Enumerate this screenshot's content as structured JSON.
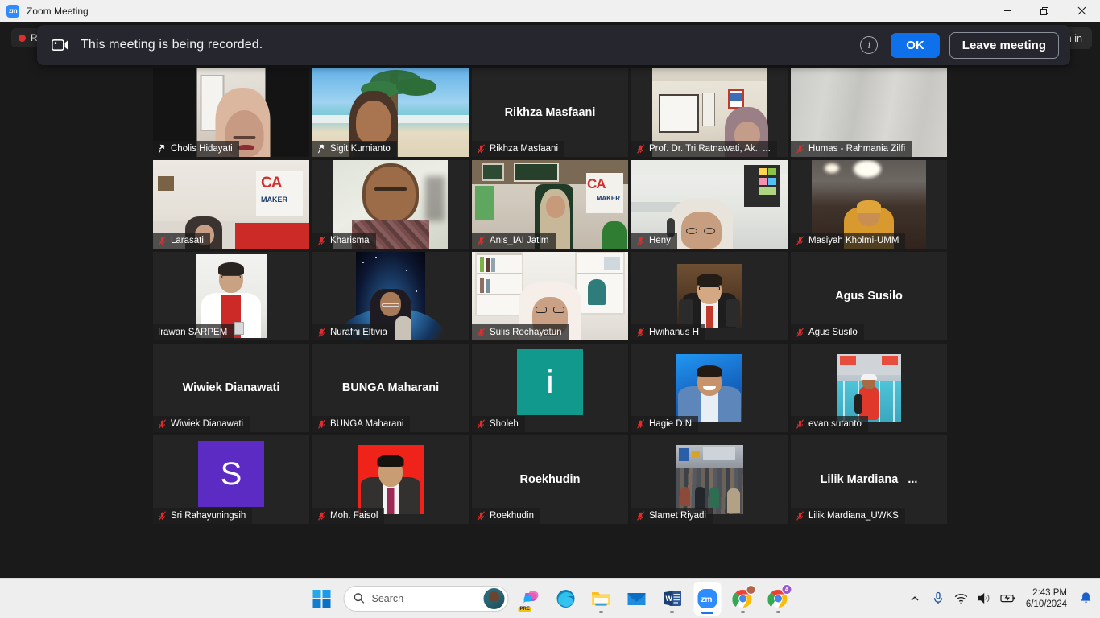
{
  "window": {
    "app_icon": "zoom-logo-icon",
    "app_icon_text": "zm",
    "title": "Zoom Meeting",
    "controls": {
      "minimize": "minimize-icon",
      "maximize": "maximize-icon",
      "close": "close-icon"
    }
  },
  "toolbar": {
    "recording_label": "Re",
    "signin_label": "gn in"
  },
  "notification": {
    "icon": "video-record-icon",
    "message": "This meeting is being recorded.",
    "info_icon": "info-icon",
    "info_glyph": "i",
    "ok_label": "OK",
    "leave_label": "Leave meeting",
    "accent_color": "#0e71eb"
  },
  "gallery": {
    "active_border_color": "#d4e157",
    "muted_icon_color": "#e02d2d",
    "rows": [
      [
        {
          "name": "Cholis Hidayati",
          "label": "Cholis Hidayati",
          "status_icon": "pinned-icon",
          "active": true,
          "mode": "video-center",
          "video": "hijab-woman-white-room"
        },
        {
          "name": "Sigit Kurnianto",
          "label": "Sigit Kurnianto",
          "status_icon": "pinned-icon",
          "active": false,
          "mode": "video-full",
          "video": "beach-palm-virtual-background"
        },
        {
          "name": "Rikhza Masfaani",
          "label": "Rikhza Masfaani",
          "status_icon": "muted-mic-icon",
          "active": false,
          "mode": "name-only",
          "display_name": "Rikhza Masfaani"
        },
        {
          "name": "Prof. Dr. Tri Ratnawati",
          "label": "Prof. Dr. Tri Ratnawati, Ak., ...",
          "status_icon": "muted-mic-icon",
          "active": false,
          "mode": "video-wide-center",
          "video": "office-room-woman-hijab"
        },
        {
          "name": "Humas - Rahmania Zilfi",
          "label": "Humas - Rahmania Zilfi",
          "status_icon": "muted-mic-icon",
          "active": false,
          "mode": "video-full",
          "video": "blurred-grey-curtain"
        }
      ],
      [
        {
          "name": "Larasati",
          "label": "Larasati",
          "status_icon": "muted-mic-icon",
          "active": false,
          "mode": "video-full",
          "video": "ca-difference-maker-banner-room"
        },
        {
          "name": "Kharisma",
          "label": "Kharisma",
          "status_icon": "muted-mic-icon",
          "active": false,
          "mode": "video-wide-center",
          "video": "man-batik-shirt"
        },
        {
          "name": "Anis_IAI Jatim",
          "label": "Anis_IAI Jatim",
          "status_icon": "muted-mic-icon",
          "active": false,
          "mode": "video-full",
          "video": "office-ca-banner-woman-hijab"
        },
        {
          "name": "Heny",
          "label": "Heny",
          "status_icon": "muted-mic-icon",
          "active": false,
          "mode": "video-full",
          "video": "office-woman-glasses-headset"
        },
        {
          "name": "Masiyah Kholmi-UMM",
          "label": "Masiyah Kholmi-UMM",
          "status_icon": "muted-mic-icon",
          "active": false,
          "mode": "video-wide-center",
          "video": "woman-orange-hijab-dark-room"
        }
      ],
      [
        {
          "name": "Irawan SARPEM",
          "label": "Irawan SARPEM",
          "status_icon": "none",
          "active": false,
          "mode": "video-portrait-tall",
          "video": "man-red-white-uniform-portrait"
        },
        {
          "name": "Nurafni Eltivia",
          "label": "Nurafni Eltivia",
          "status_icon": "muted-mic-icon",
          "active": false,
          "mode": "video-portrait-tall",
          "video": "space-earth-virtual-background"
        },
        {
          "name": "Sulis Rochayatun",
          "label": "Sulis Rochayatun",
          "status_icon": "muted-mic-icon",
          "active": false,
          "mode": "video-full",
          "video": "bookshelf-woman-glasses"
        },
        {
          "name": "Hwihanus H",
          "label": "Hwihanus H",
          "status_icon": "muted-mic-icon",
          "active": false,
          "mode": "video-portrait-photo",
          "video": "man-suit-red-tie-photo"
        },
        {
          "name": "Agus Susilo",
          "label": "Agus Susilo",
          "status_icon": "muted-mic-icon",
          "active": false,
          "mode": "name-only",
          "display_name": "Agus Susilo"
        }
      ],
      [
        {
          "name": "Wiwiek Dianawati",
          "label": "Wiwiek Dianawati",
          "status_icon": "muted-mic-icon",
          "active": false,
          "mode": "name-only",
          "display_name": "Wiwiek Dianawati"
        },
        {
          "name": "BUNGA Maharani",
          "label": "BUNGA Maharani",
          "status_icon": "muted-mic-icon",
          "active": false,
          "mode": "name-only",
          "display_name": "BUNGA Maharani"
        },
        {
          "name": "Sholeh",
          "label": "Sholeh",
          "status_icon": "muted-mic-icon",
          "active": false,
          "mode": "avatar-letter",
          "avatar_letter": "i",
          "avatar_color": "#11998e"
        },
        {
          "name": "Hagie D.N",
          "label": "Hagie D.N",
          "status_icon": "muted-mic-icon",
          "active": false,
          "mode": "video-portrait-photo",
          "video": "man-denim-jacket-blue-background"
        },
        {
          "name": "evan sutanto",
          "label": "evan sutanto",
          "status_icon": "muted-mic-icon",
          "active": false,
          "mode": "video-portrait-photo",
          "video": "runner-race-finish-line"
        }
      ],
      [
        {
          "name": "Sri Rahayuningsih",
          "label": "Sri Rahayuningsih",
          "status_icon": "muted-mic-icon",
          "active": false,
          "mode": "avatar-letter",
          "avatar_letter": "S",
          "avatar_color": "#5b2bc4"
        },
        {
          "name": "Moh. Faisol",
          "label": "Moh. Faisol",
          "status_icon": "muted-mic-icon",
          "active": false,
          "mode": "video-portrait-photo",
          "video": "man-suit-red-background-id-photo"
        },
        {
          "name": "Roekhudin",
          "label": "Roekhudin",
          "status_icon": "muted-mic-icon",
          "active": false,
          "mode": "name-only",
          "display_name": "Roekhudin"
        },
        {
          "name": "Slamet Riyadi",
          "label": "Slamet Riyadi",
          "status_icon": "muted-mic-icon",
          "active": false,
          "mode": "video-portrait-photo",
          "video": "crowded-street-photo"
        },
        {
          "name": "Lilik Mardiana_UWKS",
          "label": "Lilik Mardiana_UWKS",
          "status_icon": "muted-mic-icon",
          "active": false,
          "mode": "name-only",
          "display_name": "Lilik  Mardiana_ ..."
        }
      ]
    ]
  },
  "taskbar": {
    "start_icon": "windows-start-icon",
    "search_placeholder": "Search",
    "search_avatar": "search-avatar-icon",
    "apps": [
      {
        "icon": "copilot-pre-icon",
        "label": "PRE",
        "running": false,
        "active": false
      },
      {
        "icon": "microsoft-edge-icon",
        "label": "",
        "running": false,
        "active": false
      },
      {
        "icon": "file-explorer-icon",
        "label": "",
        "running": true,
        "active": false
      },
      {
        "icon": "mail-icon",
        "label": "",
        "running": false,
        "active": false
      },
      {
        "icon": "microsoft-word-icon",
        "label": "W",
        "running": true,
        "active": false
      },
      {
        "icon": "zoom-icon",
        "label": "zm",
        "running": true,
        "active": true
      },
      {
        "icon": "google-chrome-icon",
        "label": "",
        "running": true,
        "active": false
      },
      {
        "icon": "google-chrome-profile-a-icon",
        "label": "A",
        "running": true,
        "active": false
      }
    ],
    "tray": {
      "overflow_icon": "chevron-up-icon",
      "microphone_icon": "microphone-icon",
      "wifi_icon": "wifi-icon",
      "volume_icon": "speaker-icon",
      "battery_icon": "battery-charging-icon",
      "time": "2:43 PM",
      "date": "6/10/2024",
      "notification_icon": "bell-icon"
    }
  }
}
